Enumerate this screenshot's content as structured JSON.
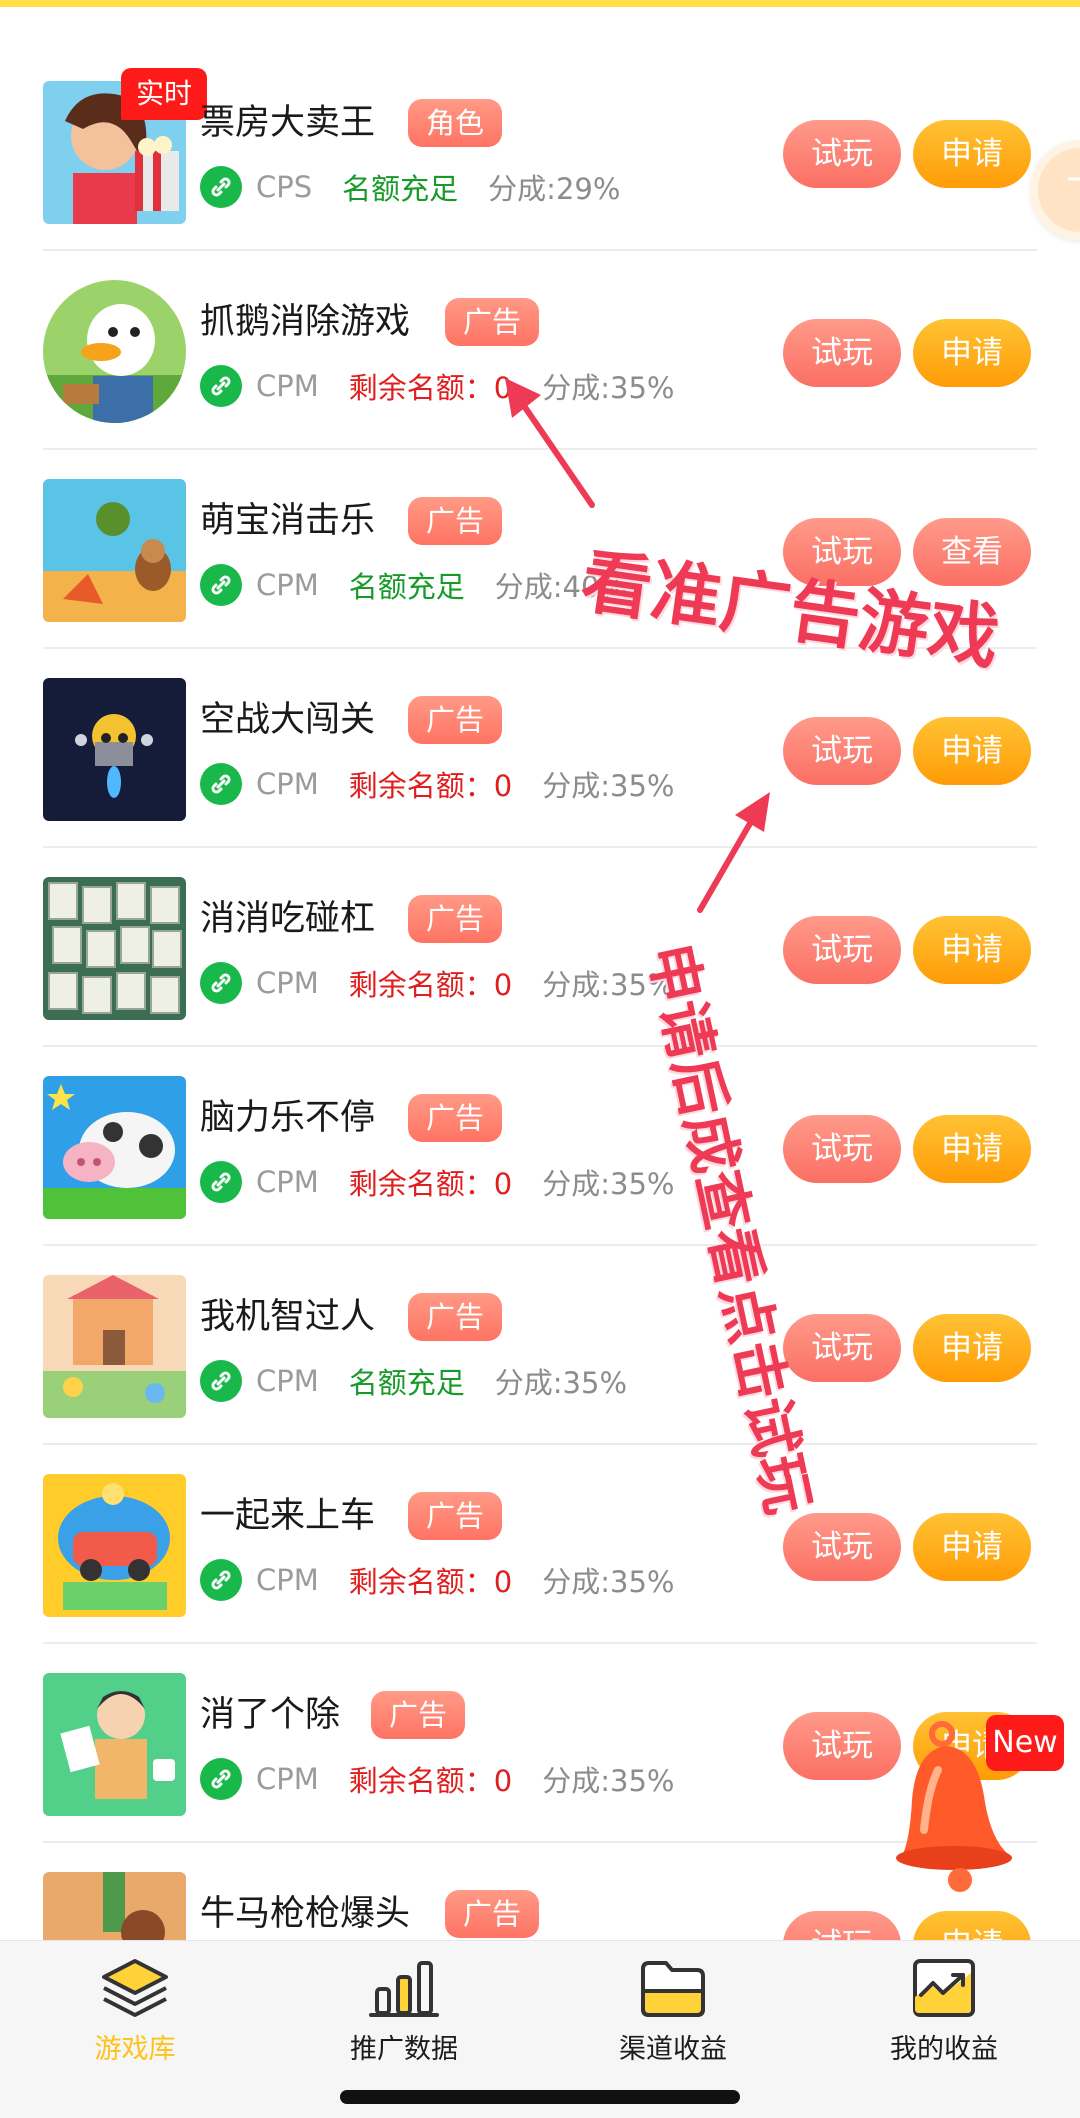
{
  "side_float_label": "下",
  "annotations": {
    "note_ad_games": "看准广告游戏",
    "note_apply_then": "申请后成查看点击试玩"
  },
  "notification": {
    "new_badge": "New"
  },
  "games": [
    {
      "title": "票房大卖王",
      "tag": "角色",
      "billing": "CPS",
      "quota": "名额充足",
      "quota_type": "ok",
      "share": "分成:29%",
      "try_label": "试玩",
      "action_label": "申请",
      "live_badge": "实时"
    },
    {
      "title": "抓鹅消除游戏",
      "tag": "广告",
      "billing": "CPM",
      "quota": "剩余名额：0",
      "quota_type": "left",
      "share": "分成:35%",
      "try_label": "试玩",
      "action_label": "申请"
    },
    {
      "title": "萌宝消击乐",
      "tag": "广告",
      "billing": "CPM",
      "quota": "名额充足",
      "quota_type": "ok",
      "share": "分成:40%",
      "try_label": "试玩",
      "action_label": "查看"
    },
    {
      "title": "空战大闯关",
      "tag": "广告",
      "billing": "CPM",
      "quota": "剩余名额：0",
      "quota_type": "left",
      "share": "分成:35%",
      "try_label": "试玩",
      "action_label": "申请"
    },
    {
      "title": "消消吃碰杠",
      "tag": "广告",
      "billing": "CPM",
      "quota": "剩余名额：0",
      "quota_type": "left",
      "share": "分成:35%",
      "try_label": "试玩",
      "action_label": "申请"
    },
    {
      "title": "脑力乐不停",
      "tag": "广告",
      "billing": "CPM",
      "quota": "剩余名额：0",
      "quota_type": "left",
      "share": "分成:35%",
      "try_label": "试玩",
      "action_label": "申请"
    },
    {
      "title": "我机智过人",
      "tag": "广告",
      "billing": "CPM",
      "quota": "名额充足",
      "quota_type": "ok",
      "share": "分成:35%",
      "try_label": "试玩",
      "action_label": "申请"
    },
    {
      "title": "一起来上车",
      "tag": "广告",
      "billing": "CPM",
      "quota": "剩余名额：0",
      "quota_type": "left",
      "share": "分成:35%",
      "try_label": "试玩",
      "action_label": "申请"
    },
    {
      "title": "消了个除",
      "tag": "广告",
      "billing": "CPM",
      "quota": "剩余名额：0",
      "quota_type": "left",
      "share": "分成:35%",
      "try_label": "试玩",
      "action_label": "申请"
    },
    {
      "title": "牛马枪枪爆头",
      "tag": "广告",
      "try_label": "试玩",
      "action_label": "申请"
    }
  ],
  "bottom_nav": [
    {
      "label": "游戏库",
      "icon": "layers-icon",
      "active": true
    },
    {
      "label": "推广数据",
      "icon": "bar-chart-icon",
      "active": false
    },
    {
      "label": "渠道收益",
      "icon": "folder-icon",
      "active": false
    },
    {
      "label": "我的收益",
      "icon": "trend-chart-icon",
      "active": false
    }
  ],
  "colors": {
    "accent_yellow": "#ffc21a",
    "try_button": "#fb6f64",
    "apply_button": "#ff9c07",
    "tag_bg": "#ff7363",
    "quota_ok": "#169a28",
    "quota_left": "#e01e1e",
    "annotation": "#ee3a54"
  }
}
